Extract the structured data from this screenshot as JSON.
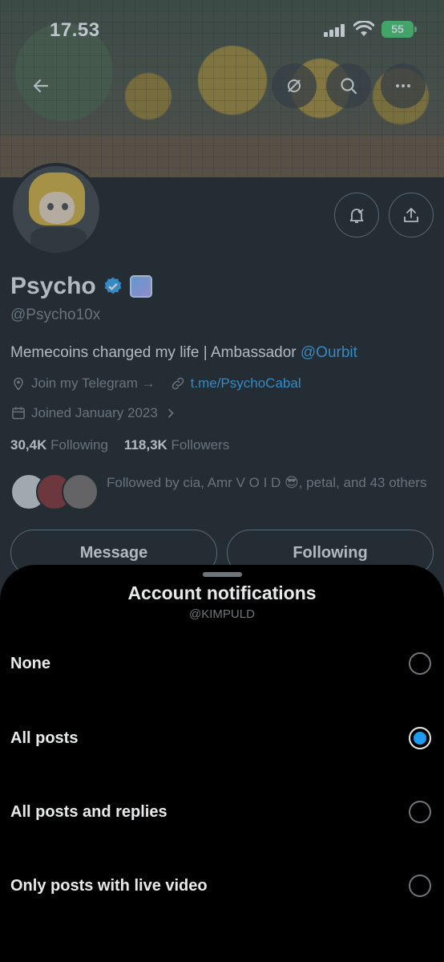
{
  "status_bar": {
    "time": "17.53",
    "battery": "55"
  },
  "profile": {
    "display_name": "Psycho",
    "handle": "@Psycho10x",
    "bio_text": "Memecoins changed my life | Ambassador ",
    "bio_mention": "@Ourbit",
    "location": "Join my Telegram →",
    "website": "t.me/PsychoCabal",
    "joined": "Joined January 2023",
    "following_count": "30,4K",
    "following_label": "Following",
    "followers_count": "118,3K",
    "followers_label": "Followers",
    "followed_by": "Followed by cia, Amr V O I D 😎, petal, and 43 others",
    "message_button": "Message",
    "following_button": "Following"
  },
  "sheet": {
    "title": "Account notifications",
    "subtitle": "@KIMPULD",
    "options": [
      {
        "label": "None",
        "selected": false
      },
      {
        "label": "All posts",
        "selected": true
      },
      {
        "label": "All posts and replies",
        "selected": false
      },
      {
        "label": "Only posts with live video",
        "selected": false
      }
    ]
  },
  "colors": {
    "accent": "#1d9bf0",
    "battery": "#34c759",
    "muted": "#71767b"
  },
  "icons": [
    "back-arrow-icon",
    "grok-icon",
    "search-icon",
    "more-icon",
    "notification-bell-icon",
    "share-icon",
    "verified-icon",
    "location-icon",
    "link-icon",
    "calendar-icon",
    "chevron-right-icon"
  ]
}
